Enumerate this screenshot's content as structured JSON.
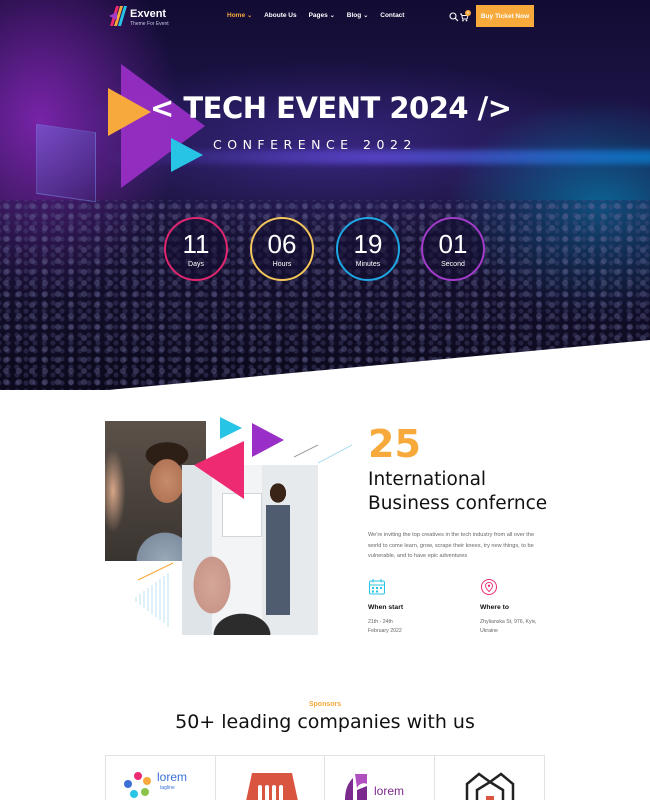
{
  "brand": {
    "name": "Exvent",
    "tagline": "Theme For Event"
  },
  "nav": {
    "items": [
      {
        "label": "Home",
        "caret": "⌄"
      },
      {
        "label": "Aboute Us",
        "caret": ""
      },
      {
        "label": "Pages",
        "caret": "⌄"
      },
      {
        "label": "Blog",
        "caret": "⌄"
      },
      {
        "label": "Contact",
        "caret": ""
      }
    ],
    "active_index": 0,
    "cart_count": "0",
    "cta_label": "Buy Ticket Now"
  },
  "hero": {
    "title": "< TECH EVENT 2024 />",
    "subtitle": "CONFERENCE 2022",
    "countdown": [
      {
        "value": "11",
        "label": "Days",
        "color": "#e0266f"
      },
      {
        "value": "06",
        "label": "Hours",
        "color": "#f3c45a"
      },
      {
        "value": "19",
        "label": "Minutes",
        "color": "#1ea7e4"
      },
      {
        "value": "01",
        "label": "Second",
        "color": "#a23bc9"
      }
    ]
  },
  "about": {
    "number": "25",
    "title_line1": "International",
    "title_line2": "Business confernce",
    "description": "We're inviting the top creatives in the tech industry from all over the world to come learn, grow, scrape their knees, try new things, to be vulnerable, and to have epic adventures",
    "when": {
      "title": "When start",
      "line1": "21th - 24th",
      "line2": "February 2022"
    },
    "where": {
      "title": "Where to",
      "line1": "Zhylianska St, 976, Kyiv,",
      "line2": "Ukraine"
    }
  },
  "sponsors": {
    "kicker": "Sponsors",
    "title": "50+ leading companies with us",
    "logo1_text": "lorem",
    "logo1_tagline": "tagline",
    "logo3_text": "lorem"
  },
  "colors": {
    "accent": "#f7a93b",
    "purple": "#a23bc9",
    "cyan": "#27c4e6",
    "pink": "#ee2a72"
  }
}
